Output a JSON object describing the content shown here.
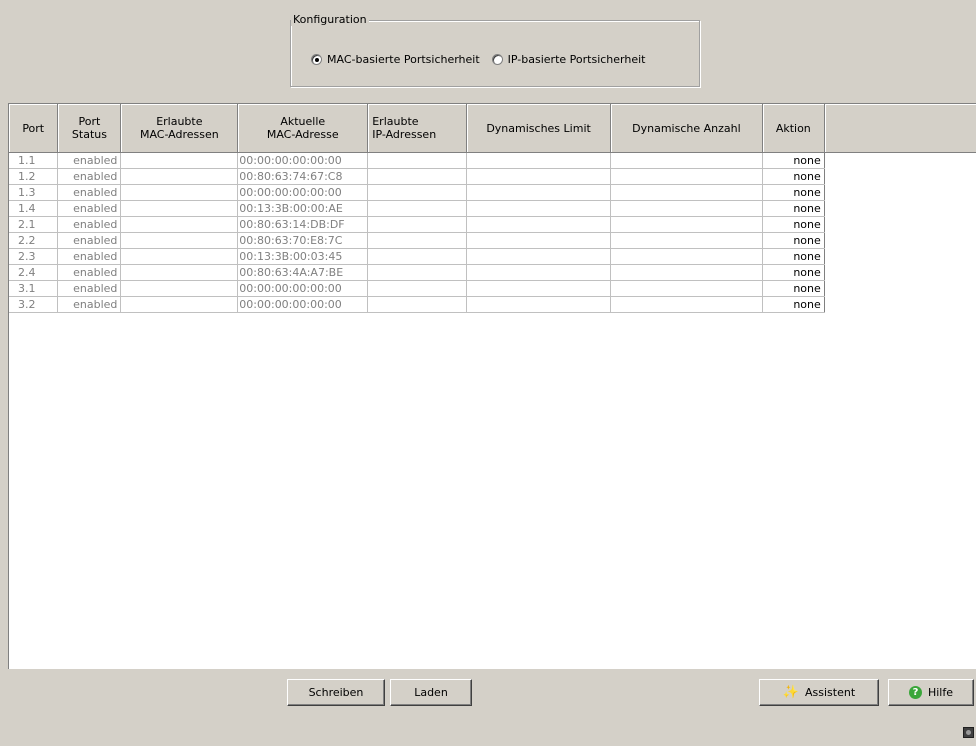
{
  "config": {
    "legend": "Konfiguration",
    "options": [
      {
        "label": "MAC-basierte Portsicherheit",
        "checked": true
      },
      {
        "label": "IP-basierte Portsicherheit",
        "checked": false
      }
    ]
  },
  "table": {
    "headers": [
      {
        "line1": "Port",
        "line2": ""
      },
      {
        "line1": "Port",
        "line2": "Status"
      },
      {
        "line1": "Erlaubte",
        "line2": "MAC-Adressen"
      },
      {
        "line1": "Aktuelle",
        "line2": "MAC-Adresse"
      },
      {
        "line1": "Erlaubte",
        "line2": "IP-Adressen"
      },
      {
        "line1": "Dynamisches Limit",
        "line2": ""
      },
      {
        "line1": "Dynamische Anzahl",
        "line2": ""
      },
      {
        "line1": "Aktion",
        "line2": ""
      }
    ],
    "rows": [
      [
        "1.1",
        "enabled",
        "",
        "00:00:00:00:00:00",
        "",
        "",
        "",
        "none"
      ],
      [
        "1.2",
        "enabled",
        "",
        "00:80:63:74:67:C8",
        "",
        "",
        "",
        "none"
      ],
      [
        "1.3",
        "enabled",
        "",
        "00:00:00:00:00:00",
        "",
        "",
        "",
        "none"
      ],
      [
        "1.4",
        "enabled",
        "",
        "00:13:3B:00:00:AE",
        "",
        "",
        "",
        "none"
      ],
      [
        "2.1",
        "enabled",
        "",
        "00:80:63:14:DB:DF",
        "",
        "",
        "",
        "none"
      ],
      [
        "2.2",
        "enabled",
        "",
        "00:80:63:70:E8:7C",
        "",
        "",
        "",
        "none"
      ],
      [
        "2.3",
        "enabled",
        "",
        "00:13:3B:00:03:45",
        "",
        "",
        "",
        "none"
      ],
      [
        "2.4",
        "enabled",
        "",
        "00:80:63:4A:A7:BE",
        "",
        "",
        "",
        "none"
      ],
      [
        "3.1",
        "enabled",
        "",
        "00:00:00:00:00:00",
        "",
        "",
        "",
        "none"
      ],
      [
        "3.2",
        "enabled",
        "",
        "00:00:00:00:00:00",
        "",
        "",
        "",
        "none"
      ]
    ]
  },
  "buttons": {
    "write": "Schreiben",
    "load": "Laden",
    "wizard": "Assistent",
    "help": "Hilfe"
  },
  "icons": {
    "wizard": "magic-wand-icon",
    "help": "help-icon",
    "status": "status-indicator-icon"
  }
}
